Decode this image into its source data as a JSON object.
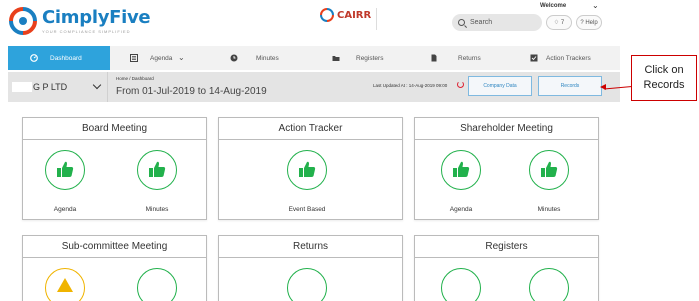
{
  "brand": {
    "name": "CimplyFive",
    "tagline": "YOUR COMPLIANCE SIMPLIFIED",
    "logo_icon": "cimplyfive-logo-icon",
    "color": "#1a7fc1"
  },
  "cairr": {
    "label": "CAIRR",
    "color": "#c0392b"
  },
  "header": {
    "welcome": "Welcome",
    "search_placeholder": "Search",
    "notifications_count": "7",
    "help_label": "Help"
  },
  "nav": {
    "active_color": "#2ea3dc",
    "items": [
      {
        "label": "Dashboard",
        "icon": "dashboard-icon",
        "active": true
      },
      {
        "label": "Agenda",
        "icon": "agenda-icon",
        "active": false
      },
      {
        "label": "Minutes",
        "icon": "clock-icon",
        "active": false
      },
      {
        "label": "Registers",
        "icon": "folder-icon",
        "active": false
      },
      {
        "label": "Returns",
        "icon": "document-icon",
        "active": false
      },
      {
        "label": "Action Trackers",
        "icon": "tracker-icon",
        "active": false
      }
    ]
  },
  "subbar": {
    "company": "G P LTD",
    "breadcrumb": "Home  /  Dashboard",
    "period": "From 01-Jul-2019 to 14-Aug-2019",
    "last_updated": "Last Updated At : 14-Aug-2019 09:00",
    "company_data_label": "Company Data",
    "records_label": "Records"
  },
  "cards": [
    {
      "title": "Board Meeting",
      "items": [
        "Agenda",
        "Minutes"
      ]
    },
    {
      "title": "Action Tracker",
      "items": [
        "Event Based"
      ]
    },
    {
      "title": "Shareholder Meeting",
      "items": [
        "Agenda",
        "Minutes"
      ]
    },
    {
      "title": "Sub-committee Meeting",
      "items": []
    },
    {
      "title": "Returns",
      "items": []
    },
    {
      "title": "Registers",
      "items": []
    }
  ],
  "callout": {
    "line1": "Click on",
    "line2": "Records",
    "color": "#cc0000"
  },
  "colors": {
    "thumb_green": "#22b14c",
    "warning_yellow": "#f0b400"
  }
}
